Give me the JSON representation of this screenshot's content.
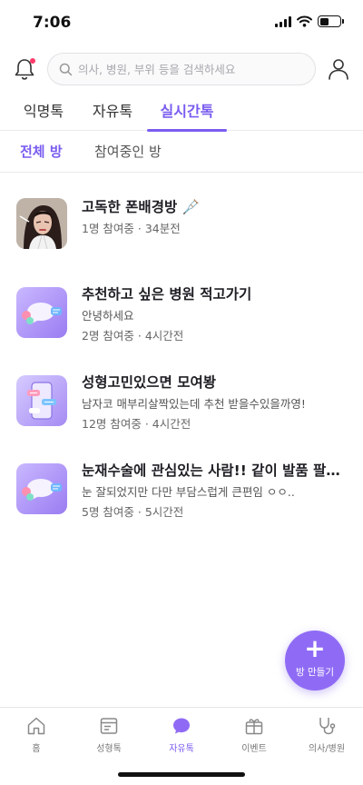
{
  "status_bar": {
    "time": "7:06"
  },
  "search": {
    "placeholder": "의사, 병원, 부위 등을 검색하세요"
  },
  "main_tabs": [
    {
      "label": "익명톡",
      "active": false
    },
    {
      "label": "자유톡",
      "active": false
    },
    {
      "label": "실시간톡",
      "active": true
    }
  ],
  "sub_tabs": [
    {
      "label": "전체 방",
      "active": true
    },
    {
      "label": "참여중인 방",
      "active": false
    }
  ],
  "rooms": [
    {
      "title": "고독한 폰배경방 🩼",
      "desc": "",
      "meta": "1명 참여중 · 34분전",
      "thumb": "portrait-photo"
    },
    {
      "title": "추천하고 싶은 병원 적고가기",
      "desc": "안녕하세요",
      "meta": "2명 참여중 · 4시간전",
      "thumb": "chat-bubbles"
    },
    {
      "title": "성형고민있으면 모여봥",
      "desc": "남자코 매부리살짝있는데 추천 받을수있을까영!",
      "meta": "12명 참여중 · 4시간전",
      "thumb": "phone-chat"
    },
    {
      "title": "눈재수술에 관심있는 사람!! 같이 발품 팔아…",
      "desc": "눈 잘되었지만 다만 부담스럽게 큰편임 ㅇㅇ..",
      "meta": "5명 참여중 · 5시간전",
      "thumb": "chat-bubbles"
    }
  ],
  "fab": {
    "plus": "+",
    "label": "방 만들기"
  },
  "bottom_nav": [
    {
      "label": "홈",
      "icon": "home-icon",
      "active": false
    },
    {
      "label": "성형톡",
      "icon": "board-icon",
      "active": false
    },
    {
      "label": "자유톡",
      "icon": "chat-icon",
      "active": true
    },
    {
      "label": "이벤트",
      "icon": "gift-icon",
      "active": false
    },
    {
      "label": "의사/병원",
      "icon": "stethoscope-icon",
      "active": false
    }
  ],
  "colors": {
    "accent": "#7a5cf0",
    "fab": "#8f6bf5",
    "notification_dot": "#ff3b6b"
  }
}
